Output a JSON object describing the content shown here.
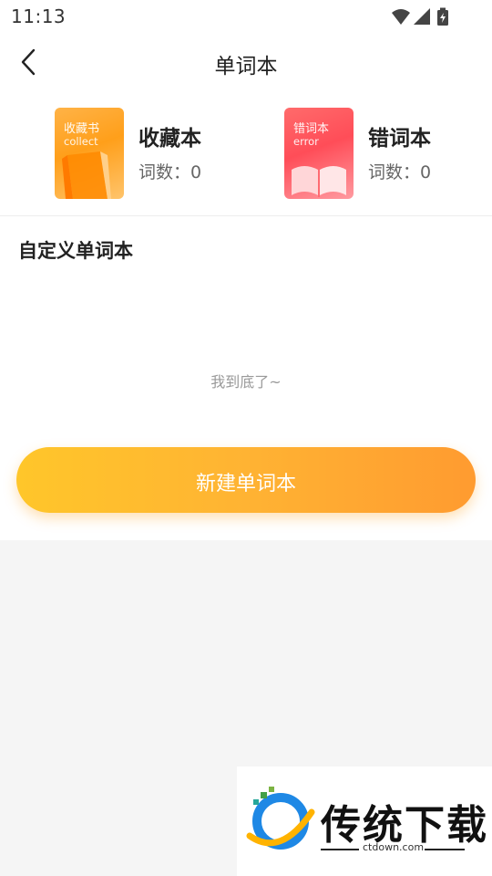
{
  "status_bar": {
    "time": "11:13",
    "icons": [
      "wifi-icon",
      "signal-icon",
      "battery-charging-icon"
    ]
  },
  "nav": {
    "title": "单词本"
  },
  "books": {
    "favorites": {
      "cover_title": "收藏书",
      "cover_subtitle": "collect",
      "name": "收藏本",
      "count_label": "词数：0"
    },
    "mistakes": {
      "cover_title": "错词本",
      "cover_subtitle": "error",
      "name": "错词本",
      "count_label": "词数：0"
    }
  },
  "custom": {
    "section_title": "自定义单词本",
    "empty_text": "我到底了~"
  },
  "new_button": {
    "label": "新建单词本"
  },
  "watermark": {
    "brand": "传统下载",
    "url": "ctdown.com"
  },
  "colors": {
    "accent_start": "#ffc62a",
    "accent_end": "#ff9b30",
    "favorites": "#ff9f1a",
    "mistakes": "#ff4d58"
  }
}
